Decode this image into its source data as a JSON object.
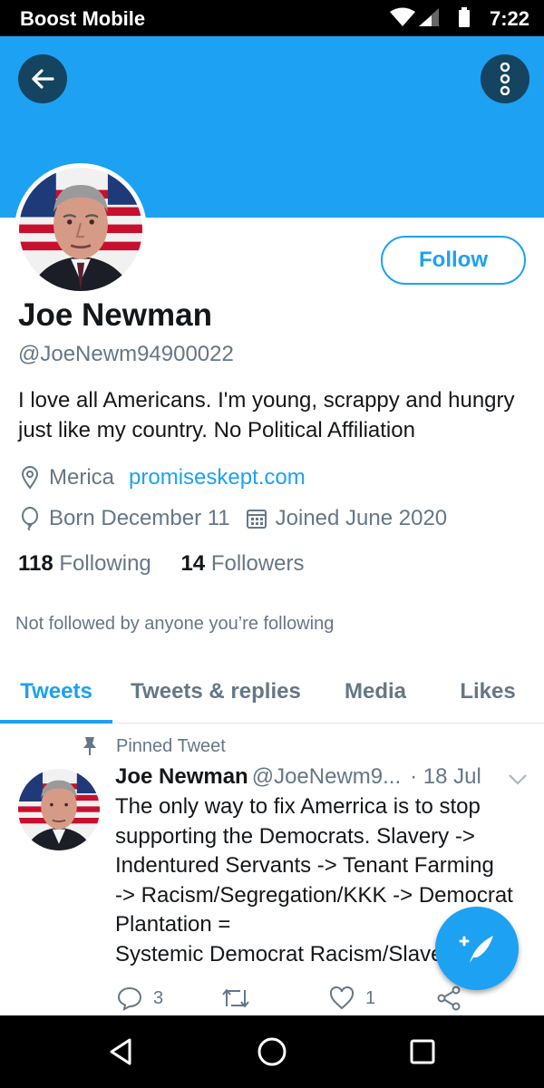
{
  "status_bar": {
    "carrier": "Boost Mobile",
    "time": "7:22",
    "icons": [
      "wifi-icon",
      "signal-icon",
      "battery-icon"
    ]
  },
  "header": {
    "back_icon": "back-arrow-icon",
    "more_icon": "more-vertical-icon",
    "banner_color": "#1da1f2"
  },
  "profile": {
    "avatar_icon": "profile-photo",
    "follow_label": "Follow",
    "name": "Joe Newman",
    "handle": "@JoeNewm94900022",
    "bio": "I love all Americans. I'm young, scrappy and hungry just like my country. No Political Affiliation",
    "location": "Merica",
    "website": "promiseskept.com",
    "born": "Born December 11",
    "joined": "Joined June 2020",
    "following_count": "118",
    "following_label": "Following",
    "followers_count": "14",
    "followers_label": "Followers",
    "not_followed": "Not followed by anyone you’re following"
  },
  "tabs": [
    {
      "label": "Tweets",
      "active": true
    },
    {
      "label": "Tweets & replies",
      "active": false
    },
    {
      "label": "Media",
      "active": false
    },
    {
      "label": "Likes",
      "active": false
    }
  ],
  "pinned_tweet": {
    "pinned_label": "Pinned Tweet",
    "name": "Joe Newman",
    "handle": "@JoeNewm9...",
    "date": "· 18 Jul",
    "lines": [
      "The only way to fix Amerrica is to stop",
      "supporting the Democrats. Slavery ->",
      "Indentured Servants -> Tenant Farming",
      "-> Racism/Segregation/KKK -> Democrat",
      "Plantation =",
      "Systemic Democrat Racism/Slavery"
    ],
    "reply_count": "3",
    "retweet_count": "",
    "like_count": "1"
  },
  "fab": {
    "icon": "compose-tweet-icon"
  },
  "navbar": {
    "icons": [
      "back-triangle-icon",
      "home-circle-icon",
      "recents-square-icon"
    ]
  },
  "colors": {
    "accent": "#1da1f2",
    "dark_button": "#14445f",
    "secondary_text": "#657786"
  }
}
